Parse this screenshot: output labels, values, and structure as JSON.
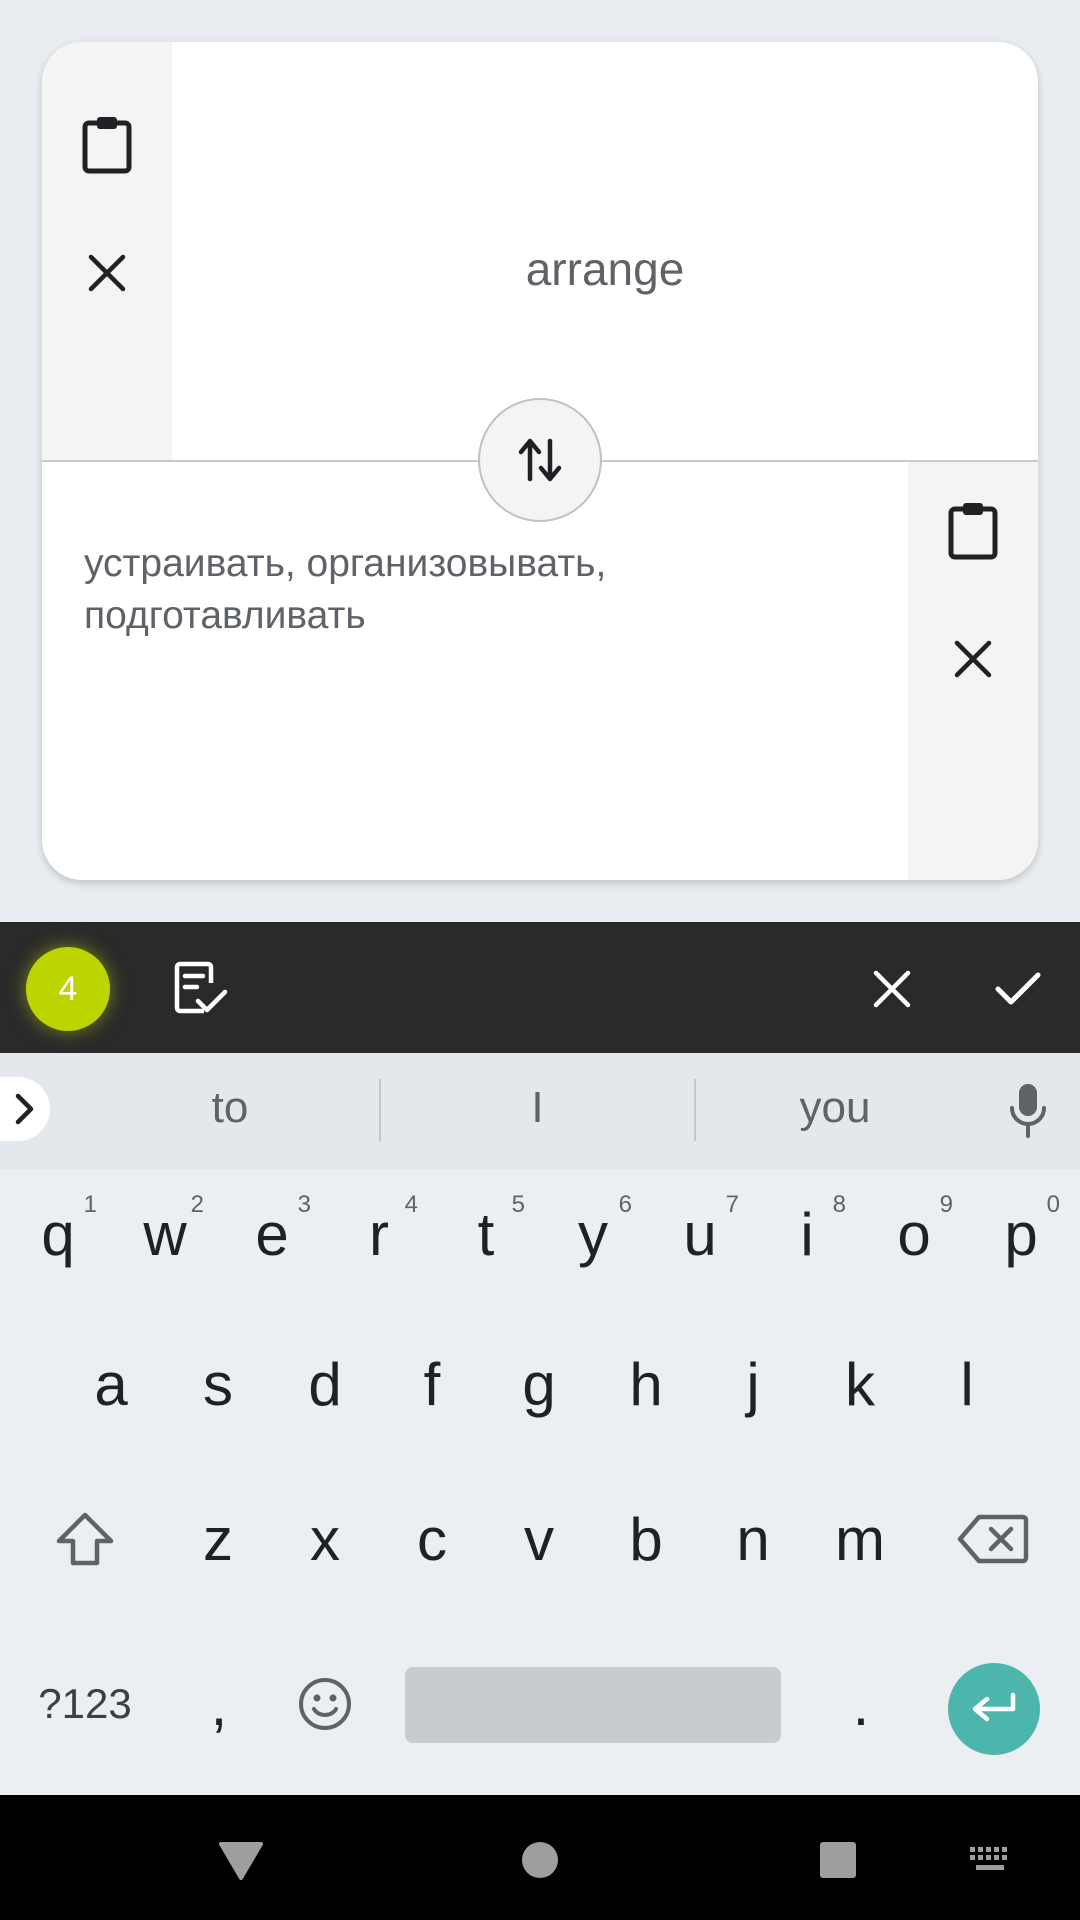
{
  "translator": {
    "source_text": "arrange",
    "translated_text": "устраивать, организовывать, подготавливать"
  },
  "toolbar": {
    "badge_count": "4"
  },
  "suggestions": [
    "to",
    "I",
    "you"
  ],
  "keyboard": {
    "row1": [
      {
        "key": "q",
        "hint": "1"
      },
      {
        "key": "w",
        "hint": "2"
      },
      {
        "key": "e",
        "hint": "3"
      },
      {
        "key": "r",
        "hint": "4"
      },
      {
        "key": "t",
        "hint": "5"
      },
      {
        "key": "y",
        "hint": "6"
      },
      {
        "key": "u",
        "hint": "7"
      },
      {
        "key": "i",
        "hint": "8"
      },
      {
        "key": "o",
        "hint": "9"
      },
      {
        "key": "p",
        "hint": "0"
      }
    ],
    "row2": [
      "a",
      "s",
      "d",
      "f",
      "g",
      "h",
      "j",
      "k",
      "l"
    ],
    "row3": [
      "z",
      "x",
      "c",
      "v",
      "b",
      "n",
      "m"
    ],
    "symbols_label": "?123",
    "comma": ",",
    "period": "."
  },
  "colors": {
    "accent_badge": "#bcd400",
    "enter_key": "#4db6ac",
    "toolbar_bg": "#2a2a2a"
  }
}
